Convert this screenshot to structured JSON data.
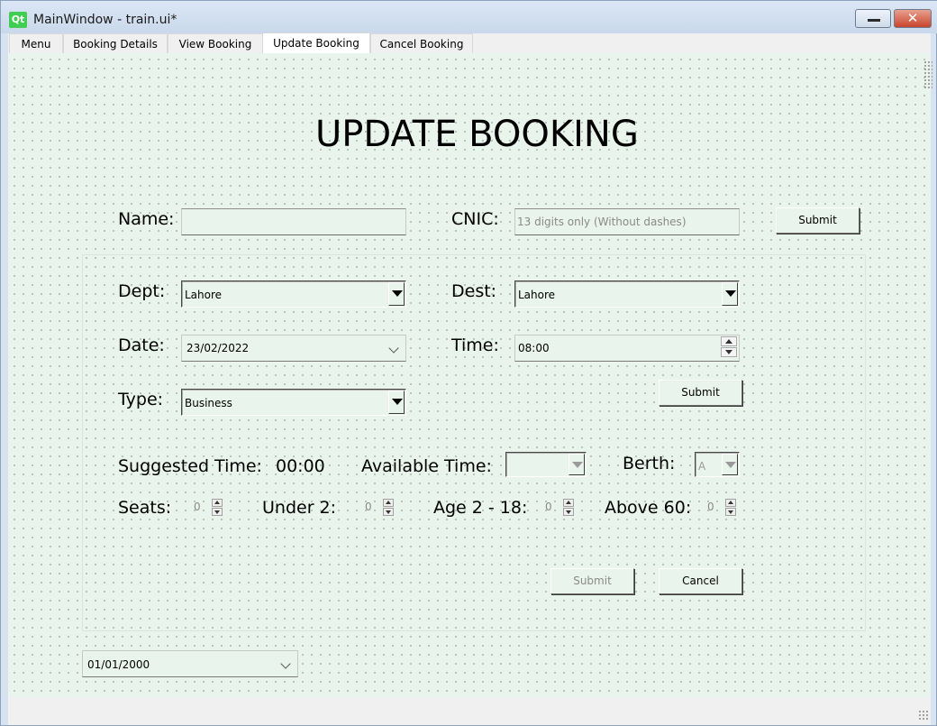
{
  "window": {
    "logo": "Qt",
    "title": "MainWindow - train.ui*",
    "close_glyph": "✕"
  },
  "tabs": [
    {
      "label": "Menu"
    },
    {
      "label": "Booking Details"
    },
    {
      "label": "View Booking"
    },
    {
      "label": "Update Booking",
      "active": true
    },
    {
      "label": "Cancel Booking"
    }
  ],
  "page": {
    "heading": "UPDATE BOOKING"
  },
  "search": {
    "name_label": "Name:",
    "name_value": "",
    "cnic_label": "CNIC:",
    "cnic_placeholder": "13 digits only (Without dashes)",
    "submit_label": "Submit"
  },
  "details": {
    "dept_label": "Dept:",
    "dept_value": "Lahore",
    "dest_label": "Dest:",
    "dest_value": "Lahore",
    "date_label": "Date:",
    "date_value": "23/02/2022",
    "time_label": "Time:",
    "time_value": "08:00",
    "type_label": "Type:",
    "type_value": "Business",
    "submit_label": "Submit"
  },
  "availability": {
    "suggested_label": "Suggested Time:",
    "suggested_value": "00:00",
    "available_label": "Available Time:",
    "available_value": "",
    "berth_label": "Berth:",
    "berth_value": "A"
  },
  "passengers": {
    "seats_label": "Seats:",
    "seats_value": "0",
    "under2_label": "Under 2:",
    "under2_value": "0",
    "age_label": "Age 2 - 18:",
    "age_value": "0",
    "above60_label": "Above 60:",
    "above60_value": "0"
  },
  "actions": {
    "submit_label": "Submit",
    "cancel_label": "Cancel"
  },
  "footer": {
    "date_value": "01/01/2000"
  },
  "colors": {
    "canvas_bg": "#e8f4ec",
    "title_bar": "#d7e3f1",
    "close_button": "#c8452d",
    "qt_logo": "#41cd52"
  }
}
